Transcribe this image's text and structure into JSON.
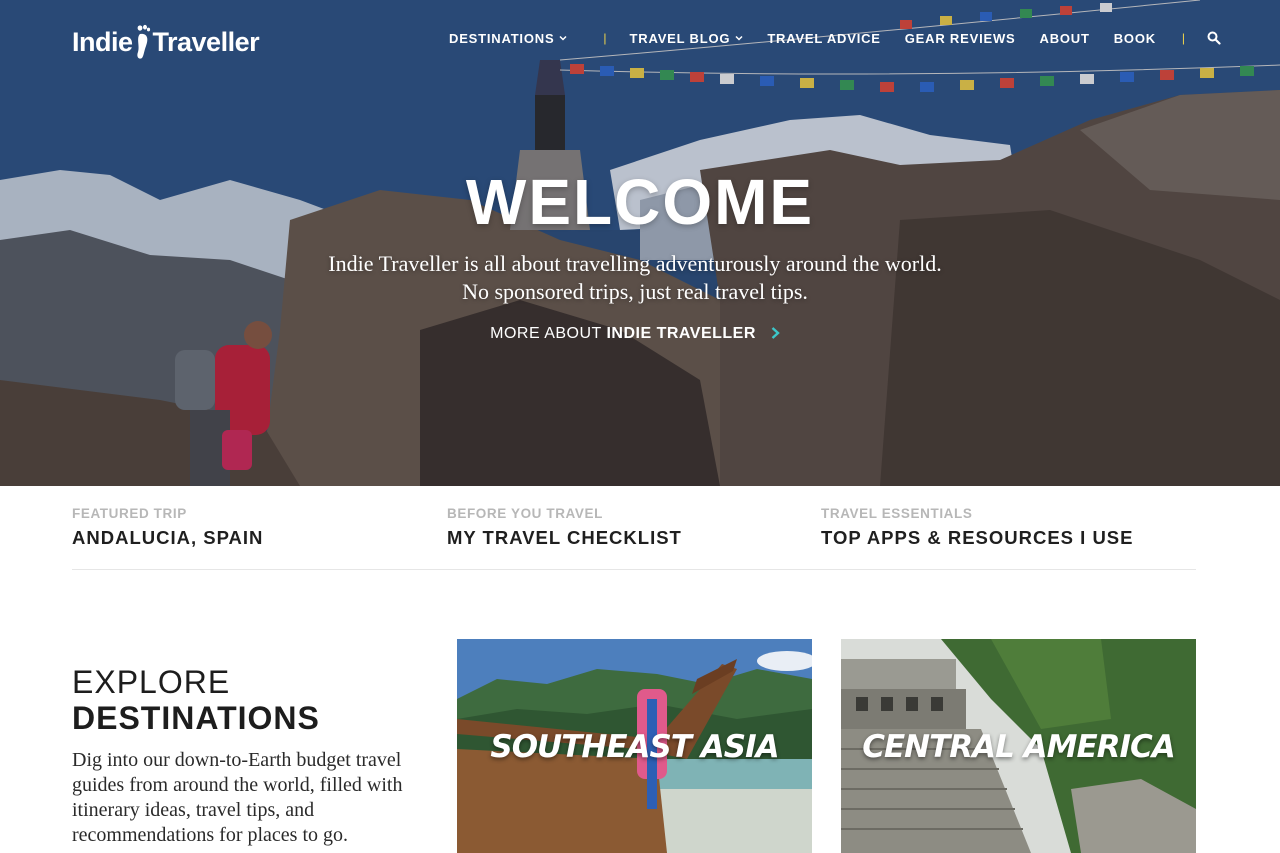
{
  "brand": {
    "logo_left": "Indie",
    "logo_right": "Traveller"
  },
  "nav": {
    "items": [
      "DESTINATIONS",
      "TRAVEL BLOG",
      "TRAVEL ADVICE",
      "GEAR REVIEWS",
      "ABOUT",
      "BOOK"
    ],
    "separator": "|"
  },
  "hero": {
    "title": "WELCOME",
    "subtitle_line1": "Indie Traveller is all about travelling adventurously around the world.",
    "subtitle_line2": "No sponsored trips, just real travel tips.",
    "link_prefix": "MORE ABOUT",
    "link_bold": "INDIE TRAVELLER"
  },
  "features": [
    {
      "kicker": "FEATURED TRIP",
      "title": "ANDALUCIA, SPAIN"
    },
    {
      "kicker": "BEFORE YOU TRAVEL",
      "title": "MY TRAVEL CHECKLIST"
    },
    {
      "kicker": "TRAVEL ESSENTIALS",
      "title": "TOP APPS & RESOURCES I USE"
    }
  ],
  "explore": {
    "heading_light": "EXPLORE",
    "heading_bold": "DESTINATIONS",
    "description": "Dig into our down-to-Earth budget travel guides from around the world, filled with itinerary ideas, travel tips, and recommendations for places to go."
  },
  "destinations": [
    {
      "label": "SOUTHEAST ASIA"
    },
    {
      "label": "CENTRAL AMERICA"
    }
  ],
  "colors": {
    "accent_teal": "#3cc7c9",
    "nav_separator": "#f2d64b",
    "kicker_gray": "#b7b7b7",
    "text_dark": "#1d1d1d"
  },
  "icons": {
    "logo_mark": "footprint-icon",
    "nav_dropdown": "chevron-down-icon",
    "search": "search-icon",
    "hero_link": "chevron-right-icon"
  }
}
